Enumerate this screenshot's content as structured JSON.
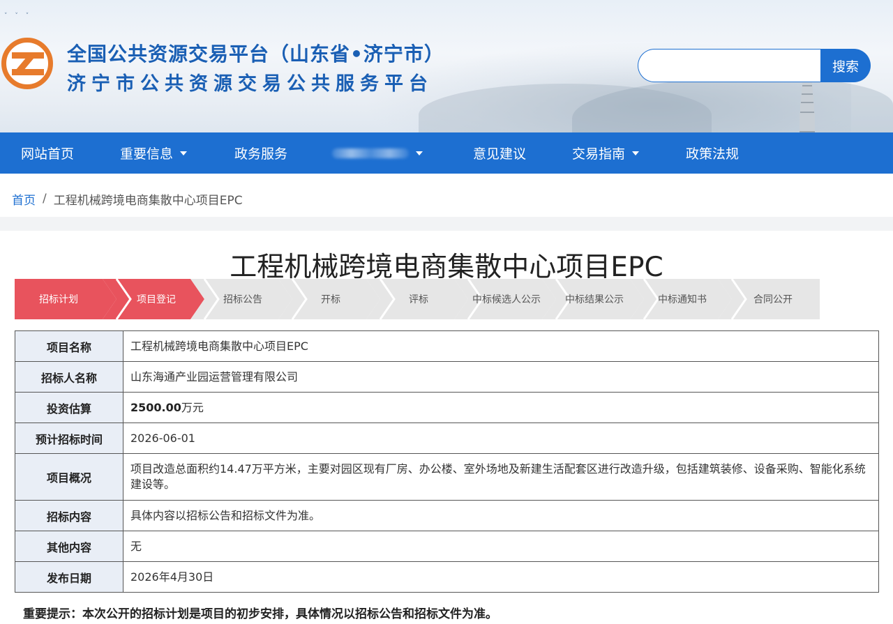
{
  "header": {
    "title_line1": "全国公共资源交易平台（山东省•济宁市）",
    "title_line2": "济宁市公共资源交易公共服务平台",
    "search": {
      "placeholder": "",
      "button_label": "搜索"
    }
  },
  "nav": {
    "items": [
      {
        "label": "网站首页",
        "dropdown": false
      },
      {
        "label": "重要信息",
        "dropdown": true
      },
      {
        "label": "政务服务",
        "dropdown": false
      },
      {
        "label": "",
        "dropdown": true,
        "obscured": true
      },
      {
        "label": "意见建议",
        "dropdown": false
      },
      {
        "label": "交易指南",
        "dropdown": true
      },
      {
        "label": "政策法规",
        "dropdown": false
      }
    ]
  },
  "breadcrumb": {
    "home": "首页",
    "separator": "/",
    "current": "工程机械跨境电商集散中心项目EPC"
  },
  "page_title": "工程机械跨境电商集散中心项目EPC",
  "steps": [
    {
      "label": "招标计划",
      "state": "active"
    },
    {
      "label": "项目登记",
      "state": "active"
    },
    {
      "label": "招标公告",
      "state": "inactive"
    },
    {
      "label": "开标",
      "state": "inactive"
    },
    {
      "label": "评标",
      "state": "inactive"
    },
    {
      "label": "中标候选人公示",
      "state": "inactive"
    },
    {
      "label": "中标结果公示",
      "state": "inactive"
    },
    {
      "label": "中标通知书",
      "state": "inactive"
    },
    {
      "label": "合同公开",
      "state": "inactive"
    }
  ],
  "info": {
    "project_name": {
      "key": "项目名称",
      "value": "工程机械跨境电商集散中心项目EPC"
    },
    "tenderer": {
      "key": "招标人名称",
      "value": "山东海通产业园运营管理有限公司"
    },
    "investment": {
      "key": "投资估算",
      "amount": "2500.00",
      "unit": "万元"
    },
    "planned_time": {
      "key": "预计招标时间",
      "value": "2026-06-01"
    },
    "overview": {
      "key": "项目概况",
      "value": "项目改造总面积约14.47万平方米，主要对园区现有厂房、办公楼、室外场地及新建生活配套区进行改造升级，包括建筑装修、设备采购、智能化系统建设等。"
    },
    "content": {
      "key": "招标内容",
      "value": "具体内容以招标公告和招标文件为准。"
    },
    "other": {
      "key": "其他内容",
      "value": "无"
    },
    "publish_date": {
      "key": "发布日期",
      "value": "2026年4月30日"
    }
  },
  "notice": "重要提示：本次公开的招标计划是项目的初步安排，具体情况以招标公告和招标文件为准。",
  "colors": {
    "primary_blue": "#1d6fd1",
    "title_blue": "#1a5fb4",
    "logo_orange": "#e77b2c",
    "step_active": "#e8535d",
    "step_inactive": "#e6e6e6",
    "table_key_bg": "#e9eef6"
  }
}
